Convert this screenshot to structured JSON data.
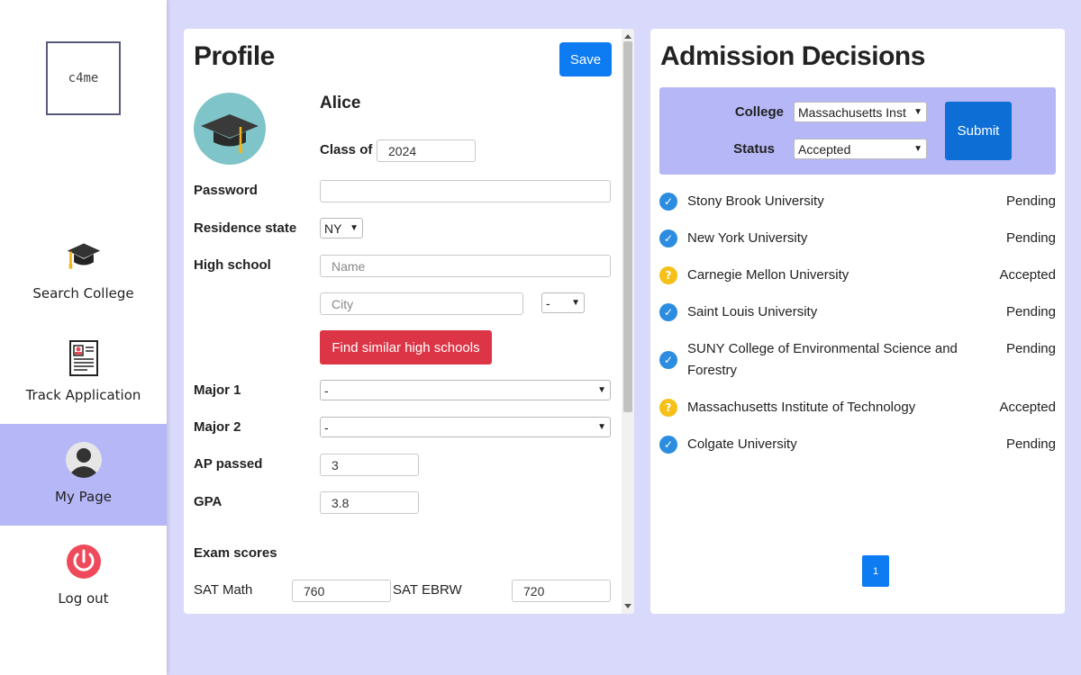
{
  "sidebar": {
    "logo": "c4me",
    "items": [
      {
        "label": "Search College",
        "icon": "graduation-cap-icon"
      },
      {
        "label": "Track Application",
        "icon": "document-icon"
      },
      {
        "label": "My Page",
        "icon": "user-avatar-icon"
      },
      {
        "label": "Log out",
        "icon": "power-icon"
      }
    ],
    "active_item": "My Page"
  },
  "profile": {
    "title": "Profile",
    "save_label": "Save",
    "name": "Alice",
    "class_of_label": "Class of",
    "class_of_value": "2024",
    "password_label": "Password",
    "password_value": "",
    "residence_label": "Residence state",
    "residence_value": "NY",
    "high_school_label": "High school",
    "hs_name_placeholder": "Name",
    "hs_city_placeholder": "City",
    "hs_state_value": "-",
    "find_label": "Find similar high schools",
    "major1_label": "Major 1",
    "major1_value": "-",
    "major2_label": "Major 2",
    "major2_value": "-",
    "ap_label": "AP passed",
    "ap_value": "3",
    "gpa_label": "GPA",
    "gpa_value": "3.8",
    "exam_label": "Exam scores",
    "sat_math_label": "SAT Math",
    "sat_math_value": "760",
    "sat_ebrw_label": "SAT EBRW",
    "sat_ebrw_value": "720"
  },
  "admission": {
    "title": "Admission Decisions",
    "college_label": "College",
    "college_value": "Massachusetts Inst",
    "status_label": "Status",
    "status_value": "Accepted",
    "submit_label": "Submit",
    "decisions": [
      {
        "name": "Stony Brook University",
        "status": "Pending",
        "icon": "check"
      },
      {
        "name": "New York University",
        "status": "Pending",
        "icon": "check"
      },
      {
        "name": "Carnegie Mellon University",
        "status": "Accepted",
        "icon": "question"
      },
      {
        "name": "Saint Louis University",
        "status": "Pending",
        "icon": "check"
      },
      {
        "name": "SUNY College of Environmental Science and Forestry",
        "status": "Pending",
        "icon": "check"
      },
      {
        "name": "Massachusetts Institute of Technology",
        "status": "Accepted",
        "icon": "question"
      },
      {
        "name": "Colgate University",
        "status": "Pending",
        "icon": "check"
      }
    ],
    "page": "1"
  },
  "colors": {
    "accent_blue": "#0d7bf2",
    "danger_red": "#dc3545",
    "active_nav": "#b6b7f7",
    "background": "#d9d9fc"
  }
}
